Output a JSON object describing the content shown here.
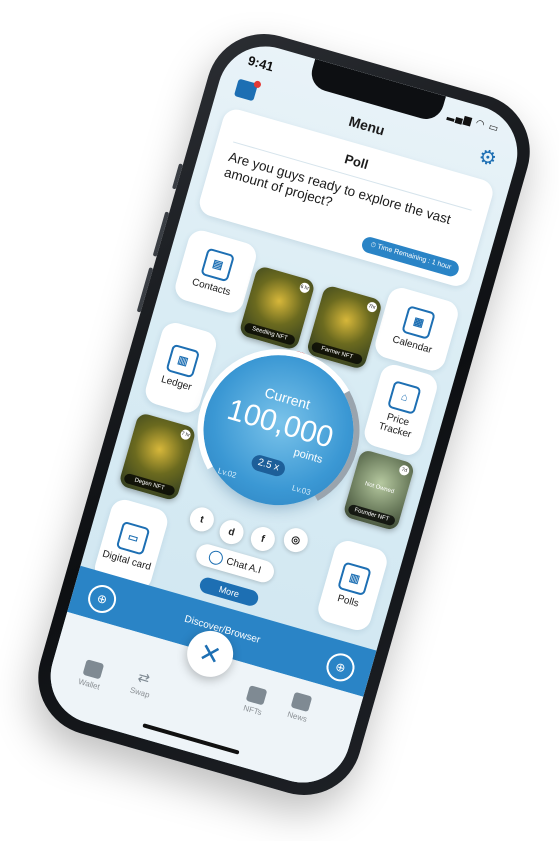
{
  "status": {
    "time": "9:41",
    "icons": "signal wifi battery"
  },
  "header": {
    "title": "Menu"
  },
  "poll": {
    "title": "Poll",
    "question": "Are you guys ready to explore the vast amount of project?",
    "timer_label": "Time Remaining : 1 hour"
  },
  "tiles": {
    "contacts": "Contacts",
    "calendar": "Calendar",
    "ledger": "Ledger",
    "price_tracker": "Price Tracker",
    "digital_card": "Digital card",
    "polls": "Polls"
  },
  "nfts": [
    {
      "label": "Seedling NFT",
      "chip": "6 hr"
    },
    {
      "label": "Farmer NFT",
      "chip": "7hr"
    },
    {
      "label": "Founder NFT",
      "chip": "7d"
    },
    {
      "label": "Degen NFT",
      "chip": "7 hr"
    }
  ],
  "nft_overlay": "Not Owned",
  "points": {
    "current_label": "Current",
    "value": "100,000",
    "unit": "points",
    "multiplier": "2.5 x",
    "level_left": "Lv.02",
    "level_right": "Lv.03",
    "progress_fraction": 0.75
  },
  "social": [
    "twitter-icon",
    "discord-icon",
    "facebook-icon",
    "instagram-icon"
  ],
  "chat_ai": {
    "label": "Chat A.I"
  },
  "more": {
    "label": "More"
  },
  "discover": {
    "label": "Discover/Browser"
  },
  "bottom_nav": {
    "wallet": "Wallet",
    "swap": "Swap",
    "nfts": "NFTs",
    "news": "News"
  },
  "colors": {
    "accent": "#2a84c6",
    "accent_dark": "#1d6fb3",
    "badge": "#e53935"
  }
}
